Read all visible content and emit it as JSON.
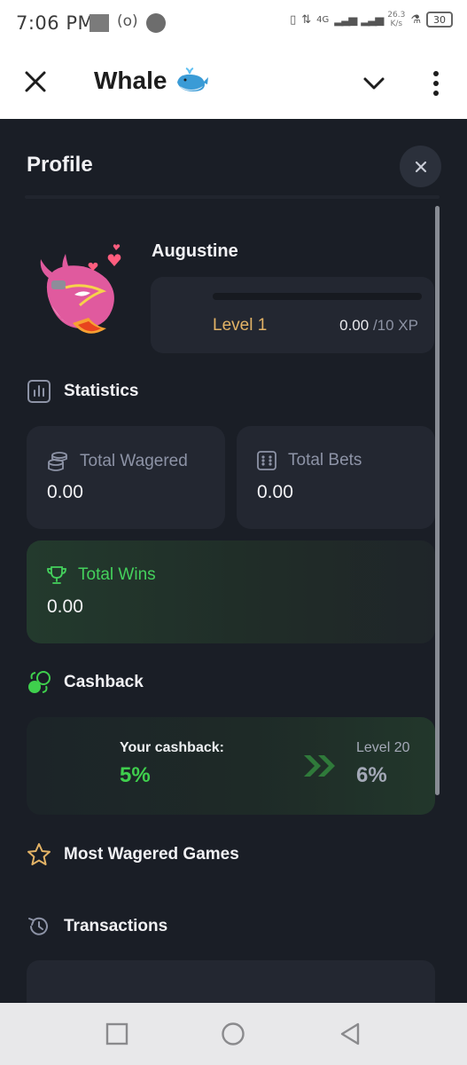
{
  "status_bar": {
    "time": "7:06 PM",
    "network": "4G",
    "speed_value": "26.3",
    "speed_unit": "K/s",
    "battery": "30"
  },
  "app_bar": {
    "title": "Whale",
    "title_emoji": "🐳"
  },
  "profile": {
    "heading": "Profile",
    "username": "Augustine",
    "level_label": "Level 1",
    "xp_current": "0.00",
    "xp_max": "/10 XP",
    "xp_progress_fraction": 0
  },
  "statistics": {
    "heading": "Statistics",
    "total_wagered_label": "Total Wagered",
    "total_wagered_value": "0.00",
    "total_bets_label": "Total Bets",
    "total_bets_value": "0.00",
    "total_wins_label": "Total Wins",
    "total_wins_value": "0.00"
  },
  "cashback": {
    "heading": "Cashback",
    "your_label": "Your cashback:",
    "your_value": "5%",
    "next_level_label": "Level 20",
    "next_level_value": "6%"
  },
  "most_wagered": {
    "heading": "Most Wagered Games"
  },
  "transactions": {
    "heading": "Transactions"
  },
  "colors": {
    "accent_gold": "#e3b366",
    "accent_green": "#44d15c",
    "panel_bg": "#1a1e26",
    "card_bg": "#232731"
  },
  "icons": [
    "close-icon",
    "chevron-down-icon",
    "more-vertical-icon",
    "statistics-icon",
    "coins-icon",
    "dice-icon",
    "trophy-icon",
    "cashback-icon",
    "star-icon",
    "history-icon"
  ]
}
